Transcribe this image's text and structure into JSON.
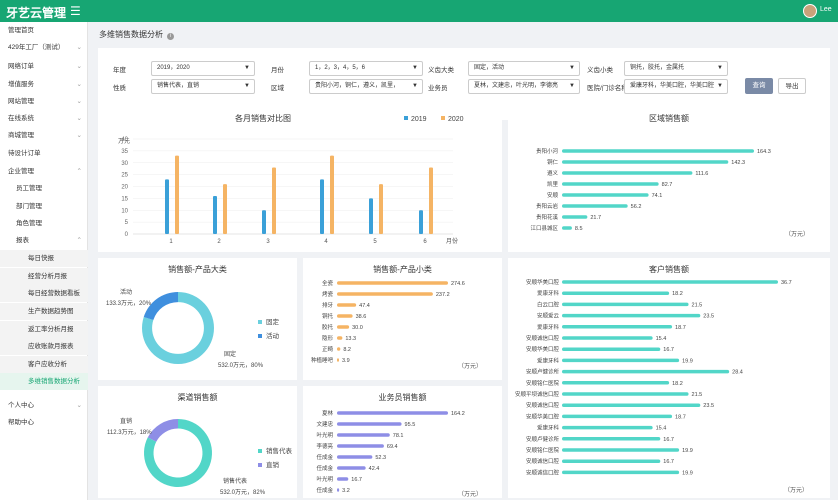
{
  "header": {
    "app_title": "牙艺云管理",
    "menu_icon": "hamburger-icon",
    "user": "Lee"
  },
  "sidebar": {
    "items": [
      {
        "label": "管理首页",
        "level": 0,
        "arrow": ""
      },
      {
        "label": "429年工厂（测试）",
        "level": 0,
        "arrow": "⌄"
      },
      {
        "label": "网络订单",
        "level": 0,
        "arrow": "⌄"
      },
      {
        "label": "增值服务",
        "level": 0,
        "arrow": "⌄"
      },
      {
        "label": "网站管理",
        "level": 0,
        "arrow": "⌄"
      },
      {
        "label": "在线系统",
        "level": 0,
        "arrow": "⌄"
      },
      {
        "label": "商城管理",
        "level": 0,
        "arrow": "⌄"
      },
      {
        "label": "待设计订单",
        "level": 0,
        "arrow": ""
      },
      {
        "label": "企业管理",
        "level": 0,
        "arrow": "⌃"
      },
      {
        "label": "员工管理",
        "level": 1,
        "arrow": ""
      },
      {
        "label": "部门管理",
        "level": 1,
        "arrow": ""
      },
      {
        "label": "角色管理",
        "level": 1,
        "arrow": ""
      },
      {
        "label": "报表",
        "level": 1,
        "arrow": "⌃"
      },
      {
        "label": "每日快报",
        "level": 2,
        "arrow": ""
      },
      {
        "label": "经营分析月报",
        "level": 2,
        "arrow": ""
      },
      {
        "label": "每日经营数据看板",
        "level": 2,
        "arrow": ""
      },
      {
        "label": "生产数据趋势图",
        "level": 2,
        "arrow": ""
      },
      {
        "label": "返工率分析月报",
        "level": 2,
        "arrow": ""
      },
      {
        "label": "应收账款月报表",
        "level": 2,
        "arrow": ""
      },
      {
        "label": "客户应收分析",
        "level": 2,
        "arrow": ""
      },
      {
        "label": "多维销售数据分析",
        "level": 2,
        "arrow": "",
        "active": true
      },
      {
        "label": "个人中心",
        "level": 0,
        "arrow": "⌄"
      },
      {
        "label": "帮助中心",
        "level": 0,
        "arrow": ""
      }
    ]
  },
  "page": {
    "title": "多维销售数据分析"
  },
  "filters": {
    "row1": [
      {
        "label": "年度",
        "value": "2019，2020"
      },
      {
        "label": "月份",
        "value": "1，2，3，4，5，6"
      },
      {
        "label": "义齿大类",
        "value": "固定，活动"
      },
      {
        "label": "义齿小类",
        "value": "铜托，胶托，金属托"
      }
    ],
    "row2": [
      {
        "label": "性质",
        "value": "销售代表，直销"
      },
      {
        "label": "区域",
        "value": "贵阳小河，铜仁，遵义，凯里，"
      },
      {
        "label": "业务员",
        "value": "夏林，文建忠，叶光明，李德亮"
      },
      {
        "label": "医院/门诊名称",
        "value": "爱康牙科，华美口腔，华美口腔"
      }
    ],
    "query_label": "查询",
    "export_label": "导出"
  },
  "colors": {
    "brand": "#17a673",
    "blue": "#3aa0d8",
    "orange": "#f5b464",
    "teal": "#52d6c8",
    "purple": "#8e8ee6"
  },
  "monthly": {
    "title": "各月销售对比图",
    "unit": "万元",
    "xlabel": "月份"
  },
  "region": {
    "title": "区域销售额",
    "unit": "（万元）"
  },
  "category": {
    "title": "销售额-产品大类"
  },
  "subcategory": {
    "title": "销售额-产品小类",
    "unit": "（万元）"
  },
  "customer": {
    "title": "客户销售额",
    "unit": "（万元）"
  },
  "channel": {
    "title": "渠道销售额"
  },
  "salesman": {
    "title": "业务员销售额",
    "unit": "（万元）"
  },
  "chart_data": [
    {
      "id": "monthly",
      "type": "bar",
      "title": "各月销售对比图",
      "categories": [
        "1",
        "2",
        "3",
        "4",
        "5",
        "6"
      ],
      "series": [
        {
          "name": "2019",
          "values": [
            23,
            16,
            10,
            23,
            15,
            10
          ]
        },
        {
          "name": "2020",
          "values": [
            33,
            21,
            28,
            33,
            21,
            28
          ]
        }
      ],
      "ylim": [
        0,
        40
      ],
      "yticks": [
        0,
        5,
        10,
        15,
        20,
        25,
        30,
        35,
        40
      ],
      "ylabel": "万元",
      "xlabel": "月份",
      "legend": "top"
    },
    {
      "id": "region",
      "type": "bar",
      "title": "区域销售额",
      "categories": [
        "贵阳小河",
        "铜仁",
        "遵义",
        "凯里",
        "安顺",
        "贵阳云岩",
        "贵阳花溪",
        "江口县城区"
      ],
      "values": [
        164.3,
        142.3,
        111.6,
        82.7,
        74.1,
        56.2,
        21.7,
        8.5
      ],
      "unit": "（万元）"
    },
    {
      "id": "category",
      "type": "pie",
      "title": "销售额-产品大类",
      "labels": [
        "固定",
        "活动"
      ],
      "values": [
        532.0,
        133.3
      ],
      "percents": [
        "80%",
        "20%"
      ],
      "callouts": [
        "532.0万元，80%",
        "133.3万元，20%"
      ]
    },
    {
      "id": "subcategory",
      "type": "bar",
      "title": "销售额-产品小类",
      "categories": [
        "全瓷",
        "烤瓷",
        "排牙",
        "铜托",
        "胶托",
        "隐形",
        "正畸",
        "种植睡吧"
      ],
      "values": [
        274.6,
        237.2,
        47.4,
        38.6,
        30.0,
        13.3,
        8.2,
        3.9
      ],
      "unit": "（万元）"
    },
    {
      "id": "customer",
      "type": "bar",
      "title": "客户销售额",
      "categories": [
        "安顺华美口腔",
        "爱康牙科",
        "白云口腔",
        "安顺爱云",
        "爱康牙科",
        "安顺诚信口腔",
        "安顺华美口腔",
        "爱康牙科",
        "安顺卢健诊所",
        "安顺铭仁医院",
        "安顺平坝诚信口腔",
        "安顺诚信口腔",
        "安顺华美口腔",
        "爱康牙科",
        "安顺卢健诊所",
        "安顺铭仁医院",
        "安顺诚信口腔",
        "安顺诚信口腔"
      ],
      "values": [
        36.7,
        18.2,
        21.5,
        23.5,
        18.7,
        15.4,
        16.7,
        19.9,
        28.4,
        18.2,
        21.5,
        23.5,
        18.7,
        15.4,
        16.7,
        19.9,
        16.7,
        19.9
      ],
      "unit": "（万元）"
    },
    {
      "id": "channel",
      "type": "pie",
      "title": "渠道销售额",
      "labels": [
        "销售代表",
        "直销"
      ],
      "values": [
        532.0,
        112.3
      ],
      "percents": [
        "82%",
        "18%"
      ],
      "callouts": [
        "532.0万元，82%",
        "112.3万元，18%"
      ]
    },
    {
      "id": "salesman",
      "type": "bar",
      "title": "业务员销售额",
      "categories": [
        "夏林",
        "文建忠",
        "叶光明",
        "李德亮",
        "任成金",
        "任成金",
        "叶光明",
        "任成金"
      ],
      "values": [
        164.2,
        95.5,
        78.1,
        69.4,
        52.3,
        42.4,
        16.7,
        3.2
      ],
      "unit": "（万元）"
    }
  ]
}
